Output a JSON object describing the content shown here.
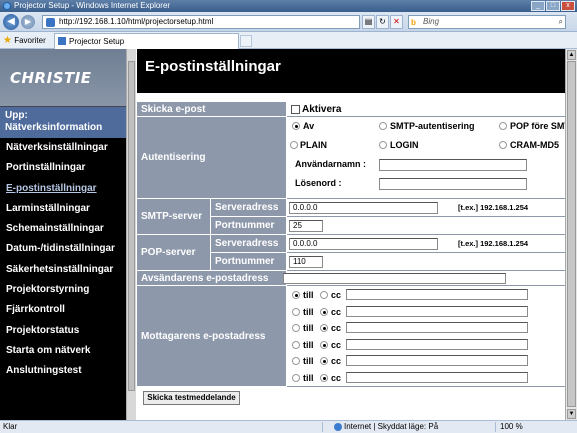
{
  "window": {
    "title": "Projector Setup - Windows Internet Explorer"
  },
  "address": {
    "url": "http://192.168.1.10/html/projectorsetup.html"
  },
  "search": {
    "placeholder": "Bing"
  },
  "favorites": {
    "label": "Favoriter"
  },
  "tab": {
    "label": "Projector Setup"
  },
  "sidebar": {
    "logo": "CHRISTIE",
    "up": "Upp: Nätverksinformation",
    "items": [
      "Nätverksinställningar",
      "Portinställningar",
      "E-postinställningar",
      "Larminställningar",
      "Schemainställningar",
      "Datum-/tidinställningar",
      "Säkerhetsinställningar",
      "Projektorstyrning",
      "Fjärrkontroll",
      "Projektorstatus",
      "Starta om nätverk",
      "Anslutningstest"
    ],
    "active_index": 2
  },
  "page": {
    "title": "E-postinställningar"
  },
  "form": {
    "send_email": {
      "label": "Skicka e-post",
      "checkbox": "Aktivera"
    },
    "auth": {
      "label": "Autentisering",
      "opt_off": "Av",
      "opt_smtp": "SMTP-autentisering",
      "opt_pop": "POP före SMTP",
      "opt_plain": "PLAIN",
      "opt_login": "LOGIN",
      "opt_cram": "CRAM-MD5",
      "username_label": "Användarnamn :",
      "password_label": "Lösenord    :",
      "username_value": "",
      "password_value": ""
    },
    "smtp": {
      "label": "SMTP-server",
      "server_label": "Serveradress",
      "server_value": "0.0.0.0",
      "example": "[t.ex.] 192.168.1.254",
      "port_label": "Portnummer",
      "port_value": "25"
    },
    "pop": {
      "label": "POP-server",
      "server_label": "Serveradress",
      "server_value": "0.0.0.0",
      "example": "[t.ex.] 192.168.1.254",
      "port_label": "Portnummer",
      "port_value": "110"
    },
    "sender": {
      "label": "Avsändarens e-postadress",
      "value": ""
    },
    "recipients": {
      "label": "Mottagarens e-postadress",
      "to": "till",
      "cc": "cc",
      "rows": [
        {
          "selected": "till",
          "value": ""
        },
        {
          "selected": "cc",
          "value": ""
        },
        {
          "selected": "cc",
          "value": ""
        },
        {
          "selected": "cc",
          "value": ""
        },
        {
          "selected": "cc",
          "value": ""
        },
        {
          "selected": "cc",
          "value": ""
        }
      ]
    },
    "test_button": "Skicka testmeddelande"
  },
  "status": {
    "left": "Klar",
    "zone": "Internet | Skyddat läge: På",
    "zoom": "100 %"
  }
}
